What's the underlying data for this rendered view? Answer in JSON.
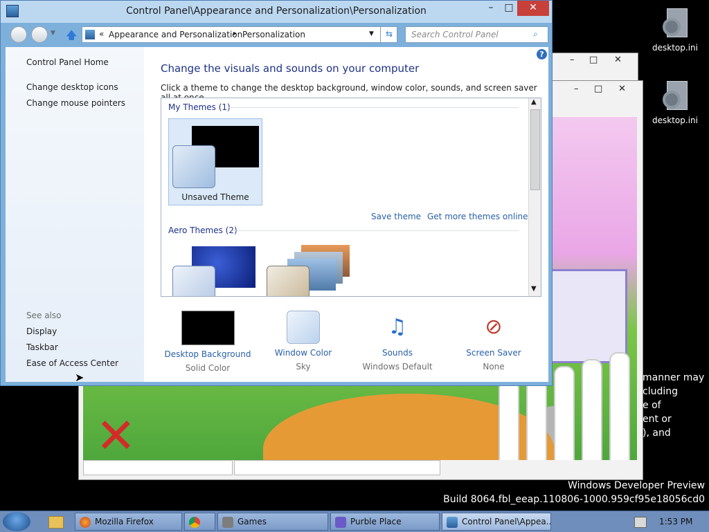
{
  "desktop": {
    "icons": [
      {
        "label": "desktop.ini"
      },
      {
        "label": "desktop.ini"
      }
    ],
    "watermark": {
      "line1": "Windows Developer Preview",
      "line2": "Build 8064.fbl_eeap.110806-1000.959cf95e18056cd0"
    },
    "background_text": [
      "manner may",
      "cluding",
      "e of",
      "ent or",
      "), and"
    ]
  },
  "window": {
    "title": "Control Panel\\Appearance and Personalization\\Personalization",
    "controls": {
      "minimize": "–",
      "maximize": "□",
      "close": "✕"
    },
    "address": {
      "prefix": "«",
      "crumbs": [
        "Appearance and Personalization",
        "Personalization"
      ],
      "separator": "▸"
    },
    "search": {
      "placeholder": "Search Control Panel"
    },
    "left_pane": {
      "home": "Control Panel Home",
      "links": [
        "Change desktop icons",
        "Change mouse pointers"
      ],
      "see_also": "See also",
      "see_also_links": [
        "Display",
        "Taskbar",
        "Ease of Access Center"
      ]
    },
    "main": {
      "heading": "Change the visuals and sounds on your computer",
      "subtext": "Click a theme to change the desktop background, window color, sounds, and screen saver all at once.",
      "my_themes": {
        "label": "My Themes (1)",
        "items": [
          {
            "name": "Unsaved Theme"
          }
        ]
      },
      "actions": {
        "save": "Save theme",
        "get_more": "Get more themes online"
      },
      "aero_themes": {
        "label": "Aero Themes (2)"
      }
    },
    "bottom_items": [
      {
        "label": "Desktop Background",
        "sub": "Solid Color"
      },
      {
        "label": "Window Color",
        "sub": "Sky"
      },
      {
        "label": "Sounds",
        "sub": "Windows Default"
      },
      {
        "label": "Screen Saver",
        "sub": "None"
      }
    ]
  },
  "taskbar": {
    "buttons": [
      {
        "label": "Mozilla Firefox"
      },
      {
        "label": ""
      },
      {
        "label": "Games"
      },
      {
        "label": "Purble Place"
      },
      {
        "label": "Control Panel\\Appea..."
      }
    ],
    "clock": "1:53 PM"
  },
  "colors": {
    "accent": "#1e3287",
    "link": "#2a60a8",
    "close_button": "#c7403a",
    "taskbar": "#6f8ebb"
  }
}
